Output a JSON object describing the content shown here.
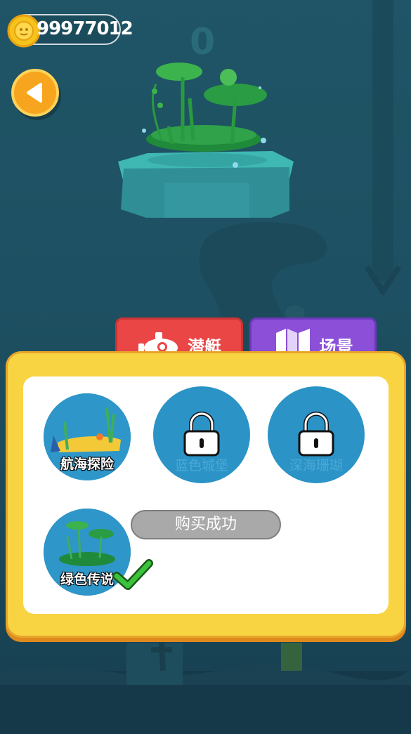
{
  "hud": {
    "coins": "99977012",
    "score": "0"
  },
  "tabs": [
    {
      "label": "潜艇",
      "icon": "submarine-icon",
      "active": false
    },
    {
      "label": "场景",
      "icon": "map-icon",
      "active": true
    }
  ],
  "scenes": [
    {
      "label": "航海探险",
      "locked": false
    },
    {
      "label": "蓝色城堡",
      "locked": true
    },
    {
      "label": "深海珊瑚",
      "locked": true
    },
    {
      "label": "绿色传说",
      "locked": false,
      "selected": true
    }
  ],
  "toast": "购买成功",
  "colors": {
    "panel": "#f8d442",
    "tab_submarine": "#ea4646",
    "tab_scene": "#8b4fd8",
    "back_button": "#f7a51f",
    "check": "#3cc23c"
  }
}
